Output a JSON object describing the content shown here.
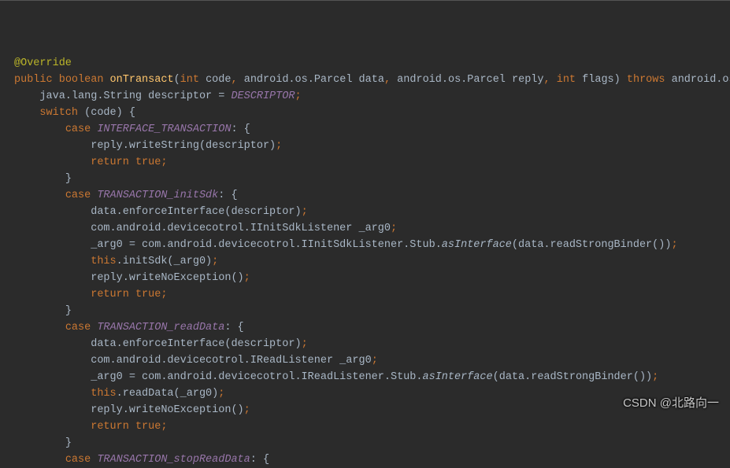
{
  "code": {
    "annotation": "@Override",
    "mod_public": "public",
    "mod_boolean": "boolean",
    "method_name": "onTransact",
    "param_int1": "int",
    "param_code": " code",
    "comma": ",",
    "sp": " ",
    "param_parcel_data": "android.os.Parcel data",
    "param_parcel_reply": "android.os.Parcel reply",
    "param_int2": "int",
    "param_flags": " flags",
    "throws": "throws",
    "throws_type": "android.os.",
    "line2a": "java.lang.String descriptor = ",
    "descriptor_const": "DESCRIPTOR",
    "switch_kw": "switch",
    "switch_expr": " (code) {",
    "case_kw": "case",
    "case1_const": "INTERFACE_TRANSACTION",
    "case_open": ": {",
    "l_reply_write_str": "reply.writeString(descriptor)",
    "return_kw": "return",
    "true_kw": "true",
    "close_brace": "}",
    "case2_const": "TRANSACTION_initSdk",
    "l_enforce": "data.enforceInterface(descriptor)",
    "l_initsdk_decl": "com.android.devicecotrol.IInitSdkListener _arg0",
    "l_initsdk_assign_pre": "_arg0 = com.android.devicecotrol.IInitSdkListener.Stub.",
    "asInterface": "asInterface",
    "l_initsdk_assign_post": "(data.readStrongBinder())",
    "this_kw": "this",
    "l_initsdk_call": ".initSdk(_arg0)",
    "l_nox": "reply.writeNoException()",
    "case3_const": "TRANSACTION_readData",
    "l_read_decl": "com.android.devicecotrol.IReadListener _arg0",
    "l_read_assign_pre": "_arg0 = com.android.devicecotrol.IReadListener.Stub.",
    "l_read_assign_post": "(data.readStrongBinder())",
    "l_read_call": ".readData(_arg0)",
    "case4_const": "TRANSACTION_stopReadData"
  },
  "watermark": "CSDN @北路向一"
}
